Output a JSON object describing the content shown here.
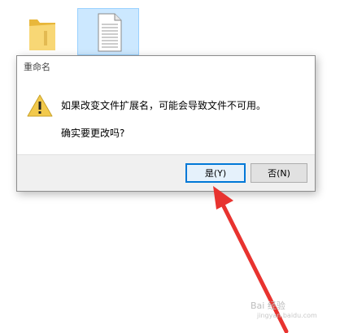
{
  "dialog": {
    "title": "重命名",
    "message": "如果改变文件扩展名，可能会导致文件不可用。",
    "question": "确实要更改吗?",
    "yes_label": "是(Y)",
    "no_label": "否(N)"
  },
  "icons": {
    "folder": "folder-icon",
    "file": "document-icon",
    "warning": "warning-icon"
  },
  "colors": {
    "accent": "#0078d7",
    "arrow": "#e8332f",
    "warning": "#f2c94c",
    "selection": "#cce8ff"
  },
  "watermark": {
    "brand": "Bai 经验",
    "url": "jingyan.baidu.com"
  }
}
